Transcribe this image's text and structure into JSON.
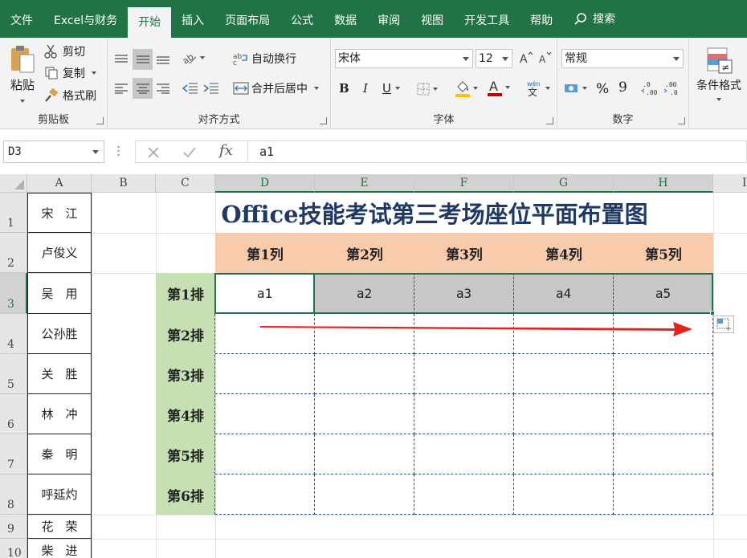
{
  "ribbon_tabs": [
    "文件",
    "Excel与财务",
    "开始",
    "插入",
    "页面布局",
    "公式",
    "数据",
    "审阅",
    "视图",
    "开发工具",
    "帮助"
  ],
  "active_tab": "开始",
  "search_label": "搜索",
  "clipboard": {
    "paste": "粘贴",
    "cut": "剪切",
    "copy": "复制",
    "format_painter": "格式刷",
    "label": "剪贴板"
  },
  "alignment": {
    "wrap": "自动换行",
    "merge": "合并后居中",
    "label": "对齐方式"
  },
  "font": {
    "name": "宋体",
    "size": "12",
    "label": "字体",
    "bold": "B",
    "italic": "I",
    "underline": "U"
  },
  "number": {
    "format": "常规",
    "label": "数字",
    "percent": "%",
    "comma": "9"
  },
  "styles": {
    "conditional": "条件格式"
  },
  "formula_bar": {
    "name_box": "D3",
    "formula": "a1",
    "fx": "fx"
  },
  "columns": [
    "A",
    "B",
    "C",
    "D",
    "E",
    "F",
    "G",
    "H",
    "I"
  ],
  "rows": [
    "1",
    "2",
    "3",
    "4",
    "5",
    "6",
    "7",
    "8",
    "9",
    "10"
  ],
  "names": [
    "宋　江",
    "卢俊义",
    "吴　用",
    "公孙胜",
    "关　胜",
    "林　冲",
    "秦　明",
    "呼延灼",
    "花　荣",
    "柴　进"
  ],
  "title": "Office技能考试第三考场座位平面布置图",
  "seat_columns": [
    "第1列",
    "第2列",
    "第3列",
    "第4列",
    "第5列"
  ],
  "seat_rows": [
    "第1排",
    "第2排",
    "第3排",
    "第4排",
    "第5排",
    "第6排"
  ],
  "row1_values": [
    "a1",
    "a2",
    "a3",
    "a4",
    "a5"
  ],
  "colors": {
    "excel_green": "#217346",
    "header_orange": "#f8cbad",
    "row_green": "#c6e0b4",
    "title_blue": "#1f3864",
    "arrow_red": "#e8221b"
  }
}
